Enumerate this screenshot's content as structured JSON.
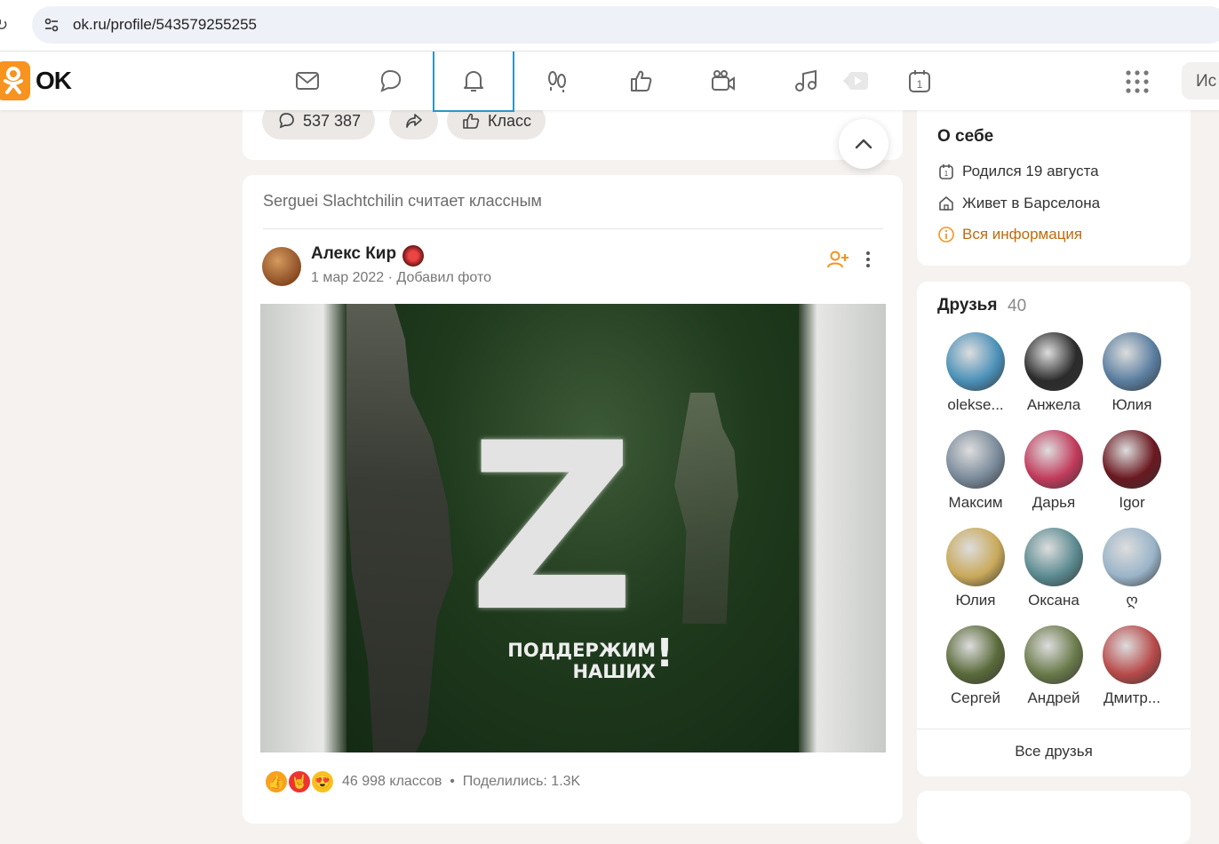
{
  "browser": {
    "url": "ok.ru/profile/543579255255"
  },
  "nav": {
    "logo_text": "OK",
    "items": [
      {
        "name": "messages",
        "icon": "envelope-icon"
      },
      {
        "name": "discussions",
        "icon": "chat-bubble-icon"
      },
      {
        "name": "notifications",
        "icon": "bell-icon",
        "active": true
      },
      {
        "name": "guests",
        "icon": "footprints-icon"
      },
      {
        "name": "events",
        "icon": "thumbs-up-icon"
      },
      {
        "name": "video",
        "icon": "camera-icon"
      },
      {
        "name": "music",
        "icon": "music-note-icon"
      },
      {
        "name": "play",
        "icon": "play-icon"
      },
      {
        "name": "calendar",
        "icon": "calendar-icon",
        "badge": "1"
      }
    ],
    "search_placeholder": "Ис"
  },
  "prev_post_actions": {
    "comments_count": "537 387",
    "class_label": "Класс"
  },
  "post": {
    "liked_by": "Serguei Slachtchilin считает классным",
    "author": "Алекс Кир",
    "date": "1 мар 2022",
    "separator": "·",
    "action": "Добавил фото",
    "image_slogan_line1": "ПОДДЕРЖИМ",
    "image_slogan_line2": "НАШИХ",
    "image_letter": "Z",
    "image_bang": "!",
    "likes": "46 998 классов",
    "stats_sep": "•",
    "shares": "Поделились: 1.3K"
  },
  "about": {
    "title": "О себе",
    "birthday": "Родился 19 августа",
    "lives": "Живет в Барселона",
    "all_info": "Вся информация"
  },
  "friends": {
    "title": "Друзья",
    "count": "40",
    "list": [
      {
        "name": "olekse...",
        "color": "#4a90b8"
      },
      {
        "name": "Анжела",
        "color": "#2b2b2b"
      },
      {
        "name": "Юлия",
        "color": "#5a7ea0"
      },
      {
        "name": "Максим",
        "color": "#7a8a9a"
      },
      {
        "name": "Дарья",
        "color": "#c23a5c"
      },
      {
        "name": "Igor",
        "color": "#6a1820"
      },
      {
        "name": "Юлия",
        "color": "#c9a95a"
      },
      {
        "name": "Оксана",
        "color": "#5a8a90"
      },
      {
        "name": "ღ",
        "color": "#9ab4c8"
      },
      {
        "name": "Сергей",
        "color": "#5a6a3a"
      },
      {
        "name": "Андрей",
        "color": "#6a7a4a"
      },
      {
        "name": "Дмитр...",
        "color": "#b84a4a"
      }
    ],
    "all_label": "Все друзья"
  },
  "colors": {
    "accent_orange": "#f7931e",
    "active_tab": "#2c96c5"
  }
}
